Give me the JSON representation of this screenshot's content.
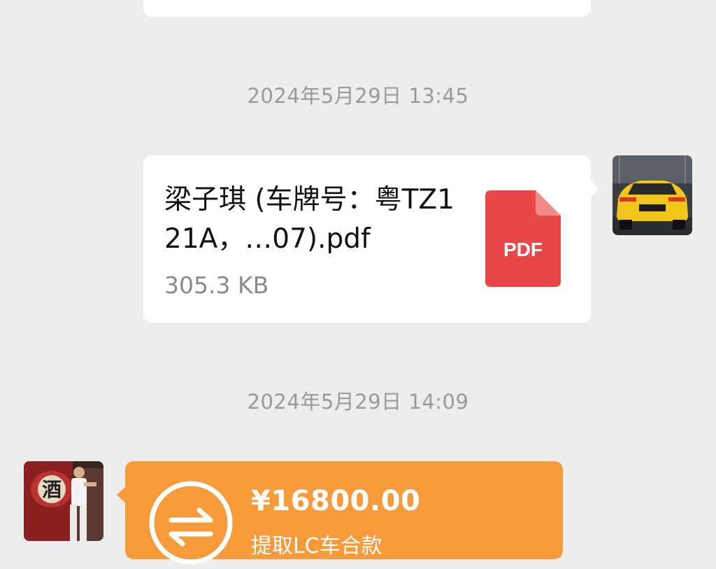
{
  "messages": [
    {
      "timestamp": "2024年5月29日 13:45",
      "type": "file",
      "file_name": "梁子琪 (车牌号：粤TZ121A，…07).pdf",
      "file_size": "305.3 KB",
      "file_icon_label": "PDF",
      "file_icon": "pdf-file-icon",
      "accent_color": "#e94848"
    },
    {
      "timestamp": "2024年5月29日 14:09",
      "type": "transfer",
      "amount": "¥16800.00",
      "memo": "提取LC车合款",
      "transfer_icon": "transfer-arrows-icon",
      "accent_color": "#f79b3a"
    }
  ],
  "avatars": {
    "self": "car-avatar",
    "contact": "person-avatar",
    "contact_sign_text": "酒"
  }
}
